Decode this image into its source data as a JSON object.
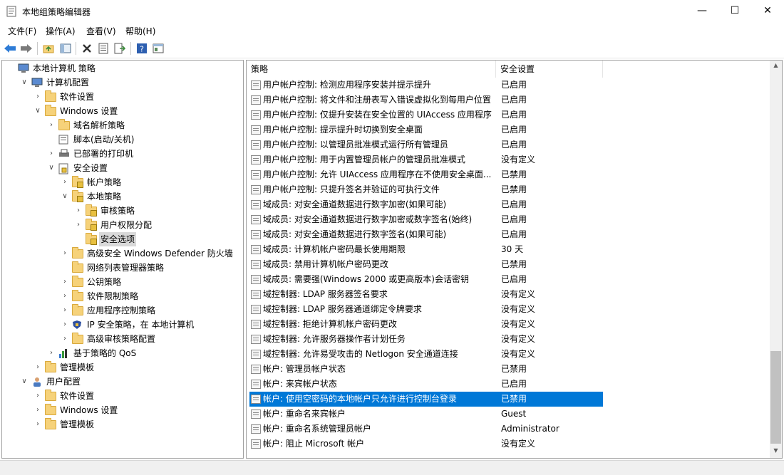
{
  "window": {
    "title": "本地组策略编辑器",
    "minimize": "—",
    "maximize": "☐",
    "close": "✕"
  },
  "menu": [
    "文件(F)",
    "操作(A)",
    "查看(V)",
    "帮助(H)"
  ],
  "toolbar": {
    "icons": [
      "back-arrow-icon",
      "forward-arrow-icon",
      "up-folder-icon",
      "show-hide-tree-icon",
      "delete-icon",
      "properties-icon",
      "export-list-icon",
      "help-icon",
      "filter-icon"
    ]
  },
  "tree": [
    {
      "label": "本地计算机 策略",
      "level": 0,
      "exp": "",
      "icon": "computer"
    },
    {
      "label": "计算机配置",
      "level": 1,
      "exp": "∨",
      "icon": "computer"
    },
    {
      "label": "软件设置",
      "level": 2,
      "exp": "›",
      "icon": "folder"
    },
    {
      "label": "Windows 设置",
      "level": 2,
      "exp": "∨",
      "icon": "folder"
    },
    {
      "label": "域名解析策略",
      "level": 3,
      "exp": "›",
      "icon": "folder"
    },
    {
      "label": "脚本(启动/关机)",
      "level": 3,
      "exp": "",
      "icon": "script"
    },
    {
      "label": "已部署的打印机",
      "level": 3,
      "exp": "›",
      "icon": "printer"
    },
    {
      "label": "安全设置",
      "level": 3,
      "exp": "∨",
      "icon": "security"
    },
    {
      "label": "帐户策略",
      "level": 4,
      "exp": "›",
      "icon": "lockfolder"
    },
    {
      "label": "本地策略",
      "level": 4,
      "exp": "∨",
      "icon": "lockfolder"
    },
    {
      "label": "审核策略",
      "level": 5,
      "exp": "›",
      "icon": "lockfolder"
    },
    {
      "label": "用户权限分配",
      "level": 5,
      "exp": "›",
      "icon": "lockfolder"
    },
    {
      "label": "安全选项",
      "level": 5,
      "exp": "",
      "icon": "lockfolder",
      "selected": true
    },
    {
      "label": "高级安全 Windows Defender 防火墙",
      "level": 4,
      "exp": "›",
      "icon": "folder"
    },
    {
      "label": "网络列表管理器策略",
      "level": 4,
      "exp": "",
      "icon": "folder"
    },
    {
      "label": "公钥策略",
      "level": 4,
      "exp": "›",
      "icon": "folder"
    },
    {
      "label": "软件限制策略",
      "level": 4,
      "exp": "›",
      "icon": "folder"
    },
    {
      "label": "应用程序控制策略",
      "level": 4,
      "exp": "›",
      "icon": "folder"
    },
    {
      "label": "IP 安全策略，在 本地计算机",
      "level": 4,
      "exp": "›",
      "icon": "ipsec"
    },
    {
      "label": "高级审核策略配置",
      "level": 4,
      "exp": "›",
      "icon": "folder"
    },
    {
      "label": "基于策略的 QoS",
      "level": 3,
      "exp": "›",
      "icon": "chart"
    },
    {
      "label": "管理模板",
      "level": 2,
      "exp": "›",
      "icon": "folder"
    },
    {
      "label": "用户配置",
      "level": 1,
      "exp": "∨",
      "icon": "user"
    },
    {
      "label": "软件设置",
      "level": 2,
      "exp": "›",
      "icon": "folder"
    },
    {
      "label": "Windows 设置",
      "level": 2,
      "exp": "›",
      "icon": "folder"
    },
    {
      "label": "管理模板",
      "level": 2,
      "exp": "›",
      "icon": "folder"
    }
  ],
  "list": {
    "col_policy": "策略",
    "col_setting": "安全设置",
    "rows": [
      {
        "name": "用户帐户控制: 检测应用程序安装并提示提升",
        "value": "已启用"
      },
      {
        "name": "用户帐户控制: 将文件和注册表写入错误虚拟化到每用户位置",
        "value": "已启用"
      },
      {
        "name": "用户帐户控制: 仅提升安装在安全位置的 UIAccess 应用程序",
        "value": "已启用"
      },
      {
        "name": "用户帐户控制: 提示提升时切换到安全桌面",
        "value": "已启用"
      },
      {
        "name": "用户帐户控制: 以管理员批准模式运行所有管理员",
        "value": "已启用"
      },
      {
        "name": "用户帐户控制: 用于内置管理员帐户的管理员批准模式",
        "value": "没有定义"
      },
      {
        "name": "用户帐户控制: 允许 UIAccess 应用程序在不使用安全桌面...",
        "value": "已禁用"
      },
      {
        "name": "用户帐户控制: 只提升签名并验证的可执行文件",
        "value": "已禁用"
      },
      {
        "name": "域成员: 对安全通道数据进行数字加密(如果可能)",
        "value": "已启用"
      },
      {
        "name": "域成员: 对安全通道数据进行数字加密或数字签名(始终)",
        "value": "已启用"
      },
      {
        "name": "域成员: 对安全通道数据进行数字签名(如果可能)",
        "value": "已启用"
      },
      {
        "name": "域成员: 计算机帐户密码最长使用期限",
        "value": "30 天"
      },
      {
        "name": "域成员: 禁用计算机帐户密码更改",
        "value": "已禁用"
      },
      {
        "name": "域成员: 需要强(Windows 2000 或更高版本)会话密钥",
        "value": "已启用"
      },
      {
        "name": "域控制器: LDAP 服务器签名要求",
        "value": "没有定义"
      },
      {
        "name": "域控制器: LDAP 服务器通道绑定令牌要求",
        "value": "没有定义"
      },
      {
        "name": "域控制器: 拒绝计算机帐户密码更改",
        "value": "没有定义"
      },
      {
        "name": "域控制器: 允许服务器操作者计划任务",
        "value": "没有定义"
      },
      {
        "name": "域控制器: 允许易受攻击的 Netlogon 安全通道连接",
        "value": "没有定义"
      },
      {
        "name": "帐户: 管理员帐户状态",
        "value": "已禁用"
      },
      {
        "name": "帐户: 来宾帐户状态",
        "value": "已启用"
      },
      {
        "name": "帐户: 使用空密码的本地帐户只允许进行控制台登录",
        "value": "已禁用",
        "selected": true
      },
      {
        "name": "帐户: 重命名来宾帐户",
        "value": "Guest"
      },
      {
        "name": "帐户: 重命名系统管理员帐户",
        "value": "Administrator"
      },
      {
        "name": "帐户: 阻止 Microsoft 帐户",
        "value": "没有定义"
      }
    ]
  },
  "scrollbar": {
    "up": "▲",
    "down": "▼"
  },
  "colors": {
    "selection": "#0078d7",
    "tree_selection": "#d9d9d9"
  }
}
